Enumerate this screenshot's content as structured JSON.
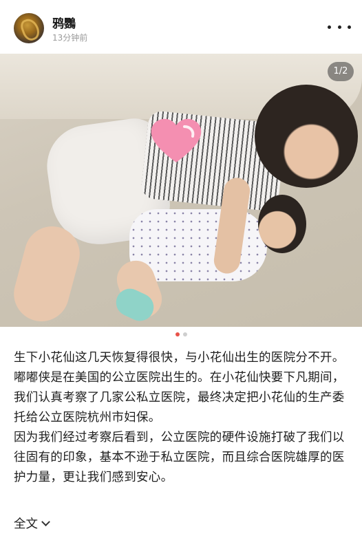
{
  "header": {
    "username": "鸦鸚",
    "timestamp": "13分钟前"
  },
  "media": {
    "counter": "1/2",
    "page_current": 1,
    "page_total": 2
  },
  "post": {
    "paragraphs": [
      "生下小花仙这几天恢复得很快，与小花仙出生的医院分不开。",
      "嘟嘟侠是在美国的公立医院出生的。在小花仙快要下凡期间，我们认真考察了几家公私立医院，最终决定把小花仙的生产委托给公立医院杭州市妇保。",
      "因为我们经过考察后看到，公立医院的硬件设施打破了我们以往固有的印象，基本不逊于私立医院，而且综合医院雄厚的医护力量，更让我们感到安心。"
    ],
    "expand_label": "全文"
  },
  "colors": {
    "accent_dot": "#e8534a",
    "heart": "#f48fb1"
  }
}
